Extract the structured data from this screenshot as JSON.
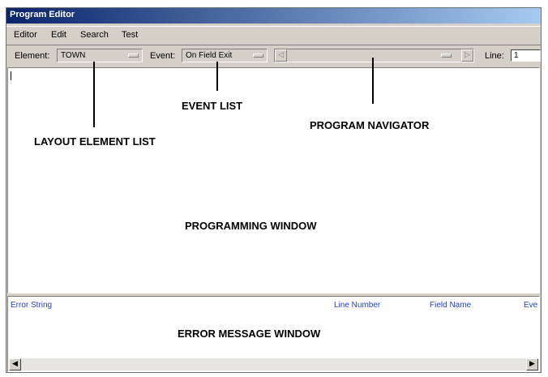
{
  "window": {
    "title": "Program Editor"
  },
  "menu": [
    "Editor",
    "Edit",
    "Search",
    "Test"
  ],
  "toolbar": {
    "element_label": "Element:",
    "element_value": "TOWN",
    "event_label": "Event:",
    "event_value": "On Field Exit",
    "line_label": "Line:",
    "line_value": "1"
  },
  "error_columns": [
    "Error String",
    "Line Number",
    "Field Name",
    "Eve"
  ],
  "annotations": {
    "layout_element_list": "LAYOUT ELEMENT LIST",
    "event_list": "EVENT LIST",
    "program_navigator": "PROGRAM NAVIGATOR",
    "programming_window": "PROGRAMMING WINDOW",
    "error_message_window": "ERROR MESSAGE WINDOW"
  },
  "icons": {
    "nav_left": "triangle-left-icon",
    "nav_right": "triangle-right-icon",
    "scroll_left": "arrow-left-icon",
    "scroll_right": "arrow-right-icon"
  },
  "colors": {
    "title_start": "#0a246a",
    "title_end": "#a6caf0",
    "error_header": "#1f3fcf",
    "chrome": "#d4d0c8"
  }
}
